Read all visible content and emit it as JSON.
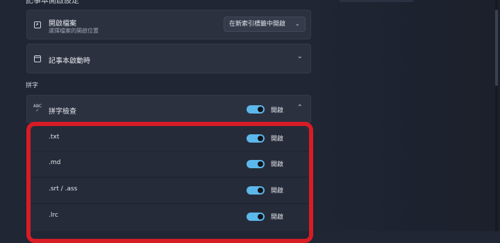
{
  "section_title_cut": "記事本開啟設定",
  "open_file": {
    "title": "開啟檔案",
    "subtitle": "選擇檔案的開啟位置",
    "dropdown_value": "在新索引標籤中開啟",
    "icon": "open-file-icon"
  },
  "notepad_launch": {
    "title": "記事本啟動時",
    "icon": "window-icon"
  },
  "spelling": {
    "group_label": "拼字",
    "spell_check": {
      "title": "拼字檢查",
      "toggle_label": "開啟",
      "toggle_on": true,
      "icon": "spellcheck-abc-icon"
    },
    "extensions": [
      {
        "name": ".txt",
        "toggle_label": "開啟",
        "on": true
      },
      {
        "name": ".md",
        "toggle_label": "開啟",
        "on": true
      },
      {
        "name": ".srt / .ass",
        "toggle_label": "開啟",
        "on": true
      },
      {
        "name": ".lrc",
        "toggle_label": "開啟",
        "on": true
      }
    ]
  },
  "colors": {
    "accent": "#5cb8ea",
    "highlight": "#d81c26",
    "card": "#2c3140",
    "background": "#202634"
  }
}
